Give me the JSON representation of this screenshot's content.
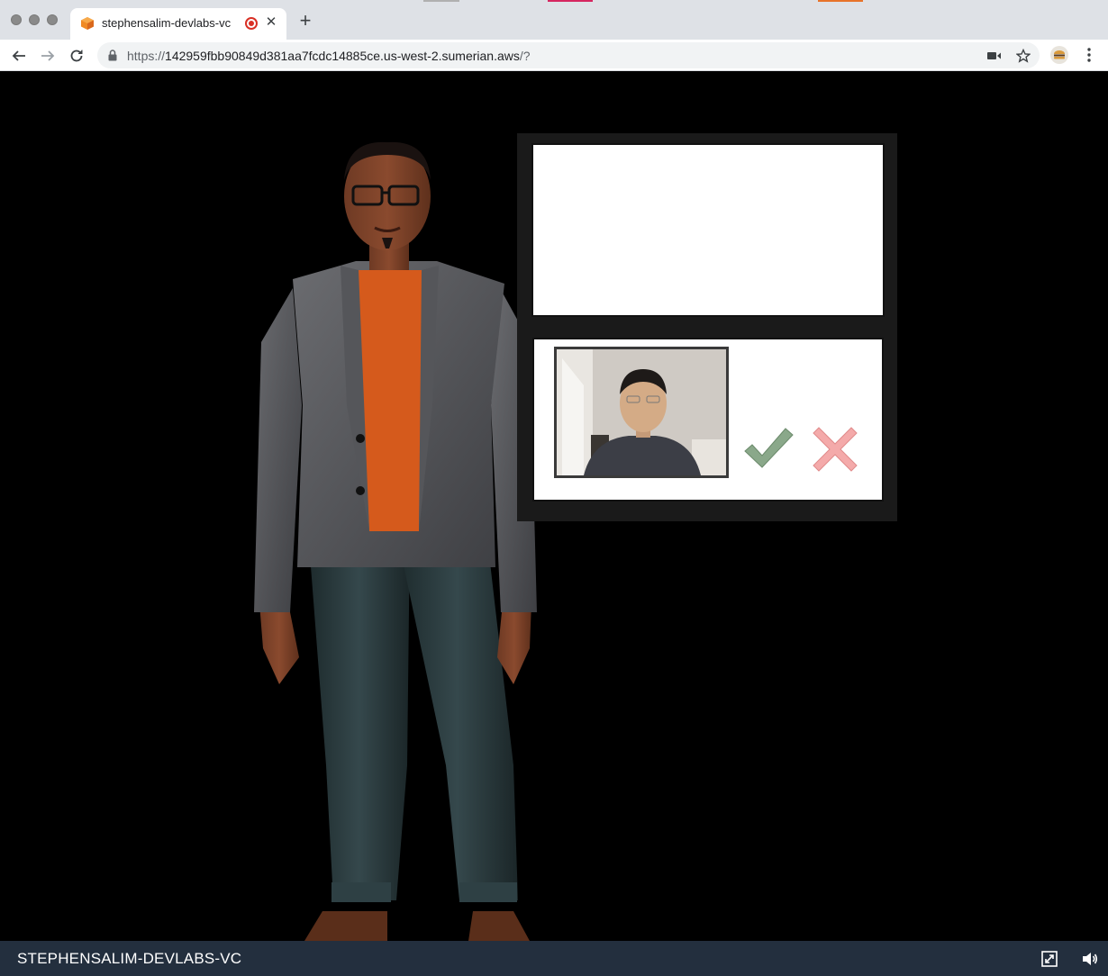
{
  "window": {
    "traffic_lights": [
      "close",
      "minimize",
      "zoom"
    ]
  },
  "tab": {
    "title": "stephensalim-devlabs-vc",
    "favicon": "sumerian-cube-icon",
    "recording_indicator": "recording-icon",
    "close_label": "✕"
  },
  "toolbar": {
    "new_tab_label": "+",
    "url_scheme": "https://",
    "url_host": "142959fbb90849d381aa7fcdc14885ce.us-west-2.sumerian.aws",
    "url_path": "/?"
  },
  "scene": {
    "confirm_icon": "checkmark-icon",
    "reject_icon": "x-icon",
    "colors": {
      "confirm": "#8aa88a",
      "reject": "#f4aaaa",
      "panel_frame": "#1a1a1a"
    }
  },
  "bottombar": {
    "title": "STEPHENSALIM-DEVLABS-VC",
    "fullscreen_icon": "fullscreen-icon",
    "volume_icon": "volume-icon",
    "background": "#232f3e"
  }
}
